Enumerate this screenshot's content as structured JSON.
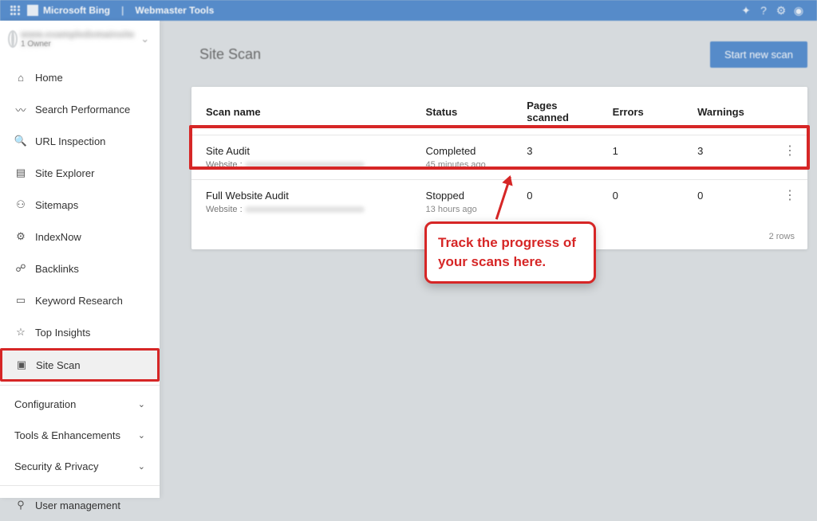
{
  "header": {
    "brand": "Microsoft Bing",
    "product": "Webmaster Tools",
    "icons": {
      "notif": "notifications",
      "help": "?",
      "settings": "settings",
      "account": "account"
    }
  },
  "sidebar": {
    "site_name": "www.exampledomainsite",
    "site_sub": "1 Owner",
    "items": [
      {
        "icon": "home-icon",
        "label": "Home"
      },
      {
        "icon": "trend-icon",
        "label": "Search Performance"
      },
      {
        "icon": "search-icon",
        "label": "URL Inspection"
      },
      {
        "icon": "explorer-icon",
        "label": "Site Explorer"
      },
      {
        "icon": "sitemap-icon",
        "label": "Sitemaps"
      },
      {
        "icon": "indexnow-icon",
        "label": "IndexNow"
      },
      {
        "icon": "backlinks-icon",
        "label": "Backlinks"
      },
      {
        "icon": "keyword-icon",
        "label": "Keyword Research"
      },
      {
        "icon": "insights-icon",
        "label": "Top Insights"
      },
      {
        "icon": "sitescan-icon",
        "label": "Site Scan"
      }
    ],
    "sections": [
      {
        "label": "Configuration"
      },
      {
        "label": "Tools & Enhancements"
      },
      {
        "label": "Security & Privacy"
      }
    ],
    "bottom": {
      "icon": "user-mgmt-icon",
      "label": "User management"
    }
  },
  "page": {
    "title": "Site Scan",
    "new_scan_btn": "Start new scan"
  },
  "table": {
    "columns": {
      "name": "Scan name",
      "status": "Status",
      "pages": "Pages scanned",
      "errors": "Errors",
      "warnings": "Warnings"
    },
    "rows": [
      {
        "name": "Site Audit",
        "website_label": "Website :",
        "status": "Completed",
        "time_ago": "45 minutes ago",
        "pages": "3",
        "errors": "1",
        "warnings": "3"
      },
      {
        "name": "Full Website Audit",
        "website_label": "Website :",
        "status": "Stopped",
        "time_ago": "13 hours ago",
        "pages": "0",
        "errors": "0",
        "warnings": "0"
      }
    ],
    "footer_rows": "2 rows"
  },
  "annotation": {
    "text": "Track the progress of your scans here."
  },
  "colors": {
    "brand_blue": "#2b70c2",
    "highlight_red": "#d62626"
  }
}
